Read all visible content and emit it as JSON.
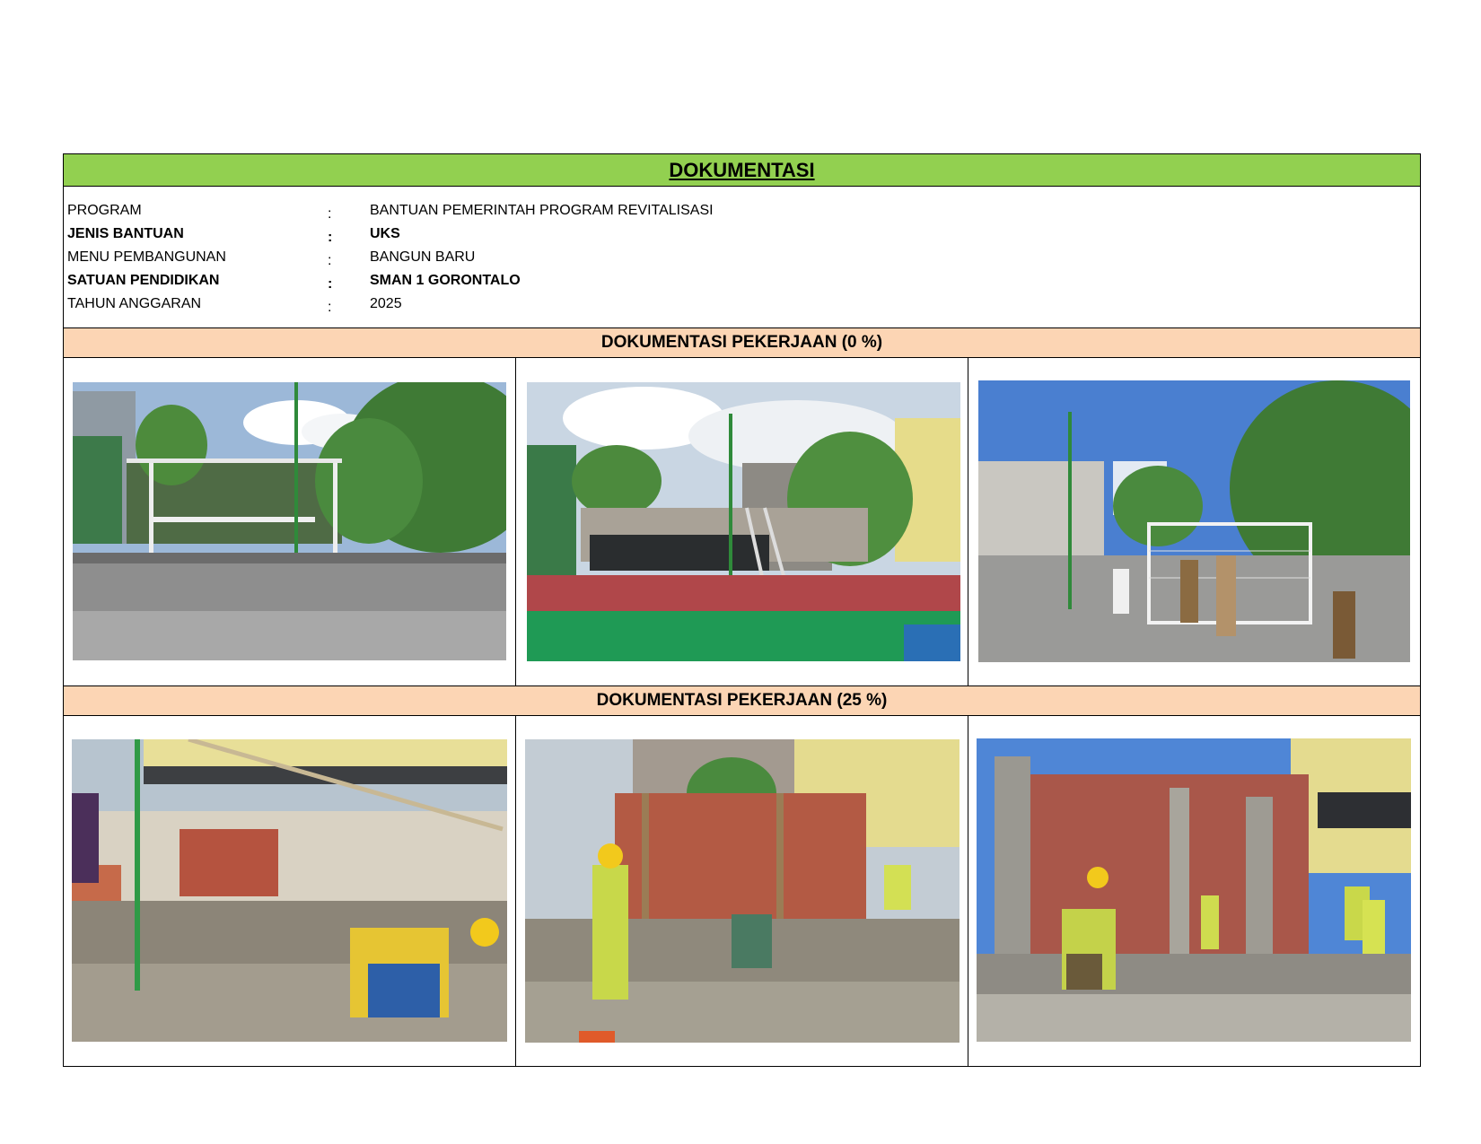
{
  "document": {
    "title": "DOKUMENTASI",
    "info_rows": [
      {
        "label": "PROGRAM",
        "separator": ":",
        "value": "BANTUAN PEMERINTAH PROGRAM REVITALISASI",
        "bold": false
      },
      {
        "label": "JENIS BANTUAN",
        "separator": ":",
        "value": "UKS",
        "bold": true
      },
      {
        "label": "MENU PEMBANGUNAN",
        "separator": ":",
        "value": "BANGUN BARU",
        "bold": false
      },
      {
        "label": "SATUAN PENDIDIKAN",
        "separator": ":",
        "value": "SMAN 1 GORONTALO",
        "bold": true
      },
      {
        "label": "TAHUN ANGGARAN",
        "separator": ":",
        "value": "2025",
        "bold": false
      }
    ],
    "sections": [
      {
        "heading": "DOKUMENTASI PEKERJAAN (0 %)"
      },
      {
        "heading": "DOKUMENTASI PEKERJAAN (25 %)"
      }
    ]
  },
  "colors": {
    "title_bar": "#92d050",
    "section_bar": "#fcd5b4",
    "border": "#000000"
  }
}
